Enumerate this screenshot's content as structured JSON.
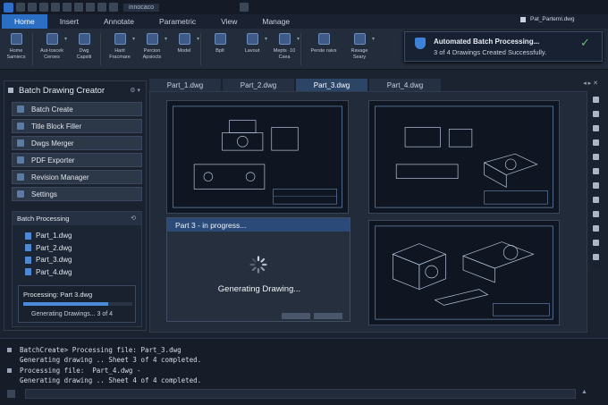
{
  "titlebar": {
    "file": "innocaco"
  },
  "ribbon_tabs": [
    "Home",
    "Insert",
    "Annotate",
    "Parametric",
    "View",
    "Manage"
  ],
  "active_file_chip": "Pat_Parteml.dwg",
  "ribbon_buttons": [
    {
      "label": "Home\nSamiecs"
    },
    {
      "label": "Aut-toscek\nCeroes"
    },
    {
      "label": "Dwg\nCapsiti"
    },
    {
      "label": "Harit\nFracmare"
    },
    {
      "label": "Percion\nApsiocts"
    },
    {
      "label": "Model\n"
    },
    {
      "label": "Bplt\n"
    },
    {
      "label": "Lavout\n"
    },
    {
      "label": "Mepts ·10\nCsea"
    },
    {
      "label": "Perste raivs\n"
    },
    {
      "label": "Ravage\nSeary"
    }
  ],
  "notification": {
    "title": "Automated Batch Processing...",
    "message": "3 of 4 Drawings Created Successfully."
  },
  "left_panel": {
    "title": "Batch Drawing Creator",
    "menu": [
      "Batch Create",
      "Title Block Filler",
      "Dwgs Merger",
      "PDF Exporter",
      "Revision Manager",
      "Settings"
    ],
    "batch": {
      "title": "Batch Processing",
      "files": [
        "Part_1.dwg",
        "Part_2.dwg",
        "Part_3.dwg",
        "Part_4.dwg"
      ],
      "status": "Processing: Part 3.dwg",
      "progress": 0.78,
      "substatus": "Generating Drawings... 3 of 4"
    }
  },
  "doc_tabs": [
    "Part_1.dwg",
    "Part_2.dwg",
    "Part_3.dwg",
    "Part_4.dwg"
  ],
  "active_doc_tab": "Part_3.dwg",
  "progress_window": {
    "title": "Part 3 - in progress...",
    "text": "Generating Drawing..."
  },
  "command_lines": [
    {
      "text": "BatchCreate> Processing file: Part_3.dwg",
      "bullet": true
    },
    {
      "text": "Generating drawing .. Sheet 3 of 4 completed.",
      "bullet": false
    },
    {
      "text": "Processing file:  Part_4.dwg -",
      "bullet": true
    },
    {
      "text": "Generating drawing .. Sheet 4 of 4 completed.",
      "bullet": false
    }
  ],
  "colors": {
    "accent": "#2b6fc4",
    "success": "#5fc46b",
    "canvas": "#0f1622"
  }
}
